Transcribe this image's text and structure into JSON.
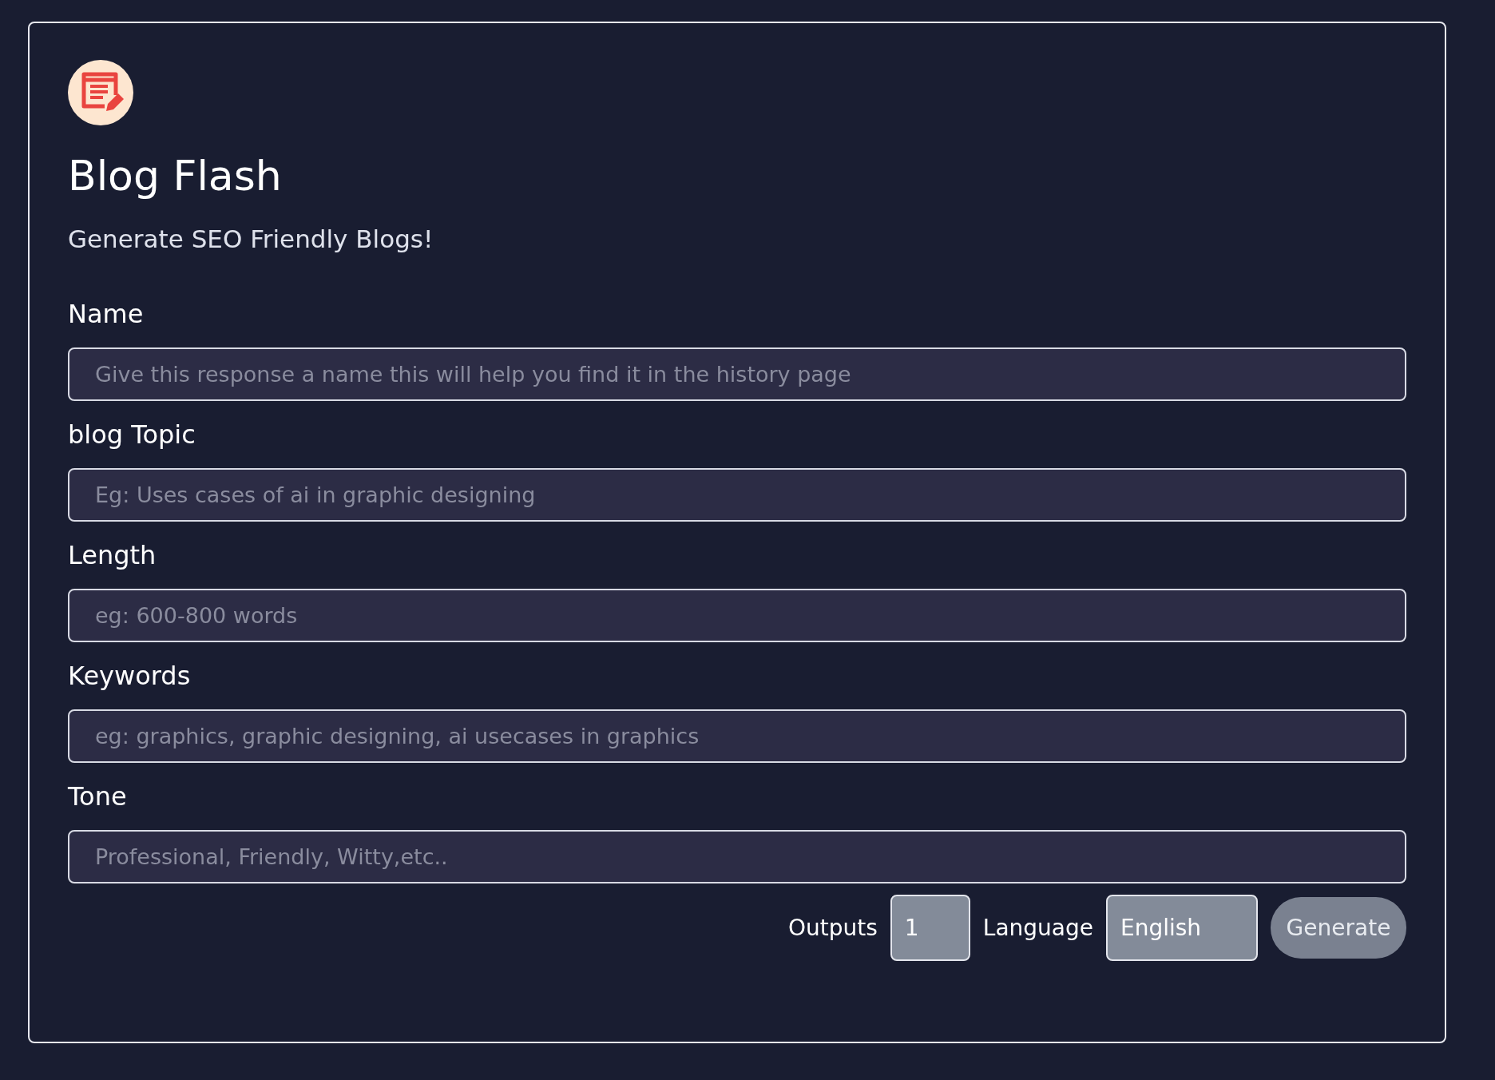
{
  "app": {
    "title": "Blog Flash",
    "subtitle": "Generate SEO Friendly Blogs!"
  },
  "fields": [
    {
      "label": "Name",
      "placeholder": "Give this response a name this will help you find it in the history page"
    },
    {
      "label": "blog Topic",
      "placeholder": "Eg: Uses cases of ai in graphic designing"
    },
    {
      "label": "Length",
      "placeholder": "eg: 600-800 words"
    },
    {
      "label": "Keywords",
      "placeholder": "eg: graphics, graphic designing, ai usecases in graphics"
    },
    {
      "label": "Tone",
      "placeholder": "Professional, Friendly, Witty,etc.."
    }
  ],
  "footer": {
    "outputs_label": "Outputs",
    "outputs_value": "1",
    "language_label": "Language",
    "language_value": "English",
    "button": "Generate"
  }
}
